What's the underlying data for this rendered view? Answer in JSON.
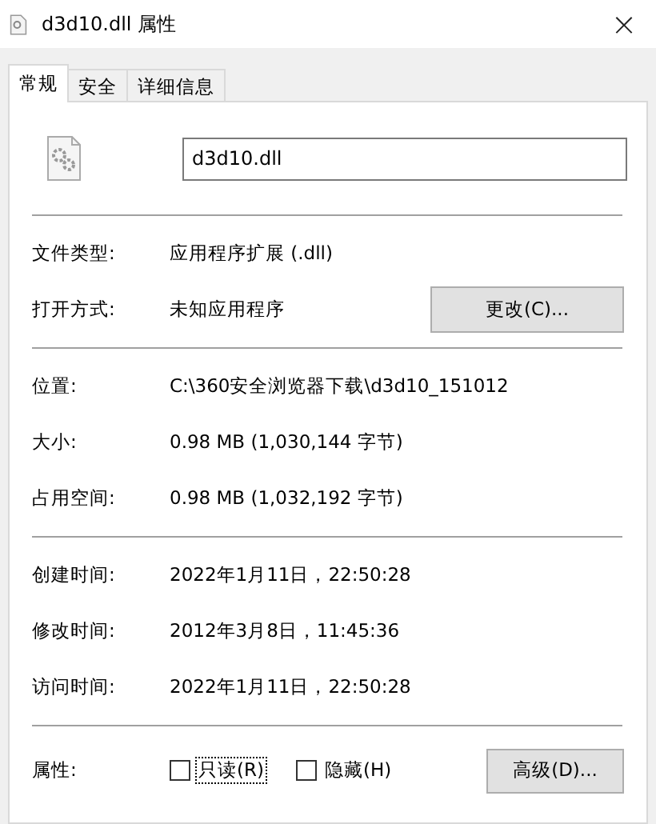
{
  "window": {
    "title": "d3d10.dll 属性",
    "close": "×"
  },
  "tabs": [
    {
      "label": "常规",
      "selected": true
    },
    {
      "label": "安全",
      "selected": false
    },
    {
      "label": "详细信息",
      "selected": false
    }
  ],
  "file_name": "d3d10.dll",
  "sections": [
    [
      {
        "label": "文件类型:",
        "value": "应用程序扩展 (.dll)"
      },
      {
        "label": "打开方式:",
        "value": "未知应用程序",
        "button": "更改(C)..."
      }
    ],
    [
      {
        "label": "位置:",
        "value": "C:\\360安全浏览器下载\\d3d10_151012"
      },
      {
        "label": "大小:",
        "value": "0.98 MB (1,030,144 字节)"
      },
      {
        "label": "占用空间:",
        "value": "0.98 MB (1,032,192 字节)"
      }
    ],
    [
      {
        "label": "创建时间:",
        "value": "2022年1月11日，22:50:28"
      },
      {
        "label": "修改时间:",
        "value": "2012年3月8日，11:45:36"
      },
      {
        "label": "访问时间:",
        "value": "2022年1月11日，22:50:28"
      }
    ]
  ],
  "attributes": {
    "label": "属性:",
    "checkboxes": [
      {
        "label": "只读(R)",
        "checked": false,
        "focused": true
      },
      {
        "label": "隐藏(H)",
        "checked": false,
        "focused": false
      }
    ],
    "button": "高级(D)..."
  }
}
